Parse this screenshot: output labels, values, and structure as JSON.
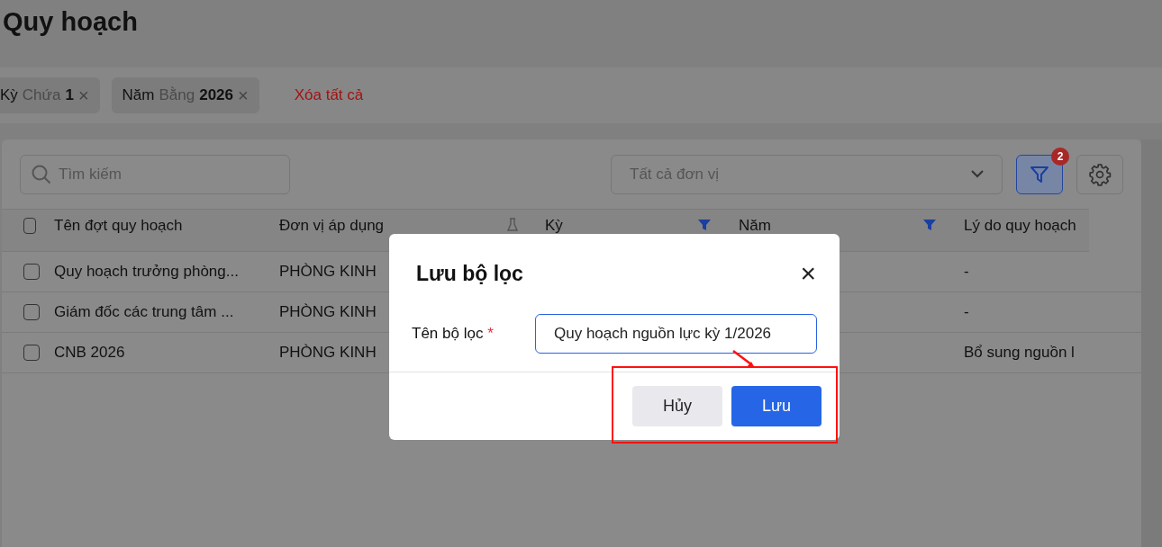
{
  "page": {
    "title": "Quy hoạch"
  },
  "filter_chips": [
    {
      "field": "Kỳ",
      "operator": "Chứa",
      "value": "1",
      "remove": "×"
    },
    {
      "field": "Năm",
      "operator": "Bằng",
      "value": "2026",
      "remove": "×"
    }
  ],
  "clear_all": "Xóa tất cả",
  "toolbar": {
    "search": {
      "placeholder": "Tìm kiếm"
    },
    "unit_select": {
      "placeholder": "Tất cả đơn vị"
    },
    "filter_badge": "2"
  },
  "table": {
    "header_checked": false,
    "columns": [
      {
        "label": "Tên đợt quy hoạch"
      },
      {
        "label": "Đơn vị áp dụng",
        "filtered": false
      },
      {
        "label": "Kỳ",
        "filtered": true
      },
      {
        "label": "Năm",
        "filtered": true
      },
      {
        "label": "Lý do quy hoạch"
      }
    ],
    "rows": [
      {
        "checked": false,
        "name": "Quy hoạch trưởng phòng...",
        "unit": "PHÒNG KINH",
        "reason": "-"
      },
      {
        "checked": false,
        "name": "Giám đốc các trung tâm ...",
        "unit": "PHÒNG KINH",
        "reason": "-"
      },
      {
        "checked": false,
        "name": "CNB 2026",
        "unit": "PHÒNG KINH",
        "reason": "Bổ sung nguồn l"
      }
    ]
  },
  "modal": {
    "title": "Lưu bộ lọc",
    "close": "×",
    "field": {
      "label": "Tên bộ lọc",
      "required_mark": "*",
      "value": "Quy hoạch nguồn lực kỳ 1/2026"
    },
    "buttons": [
      {
        "label": "Hủy",
        "kind": "secondary"
      },
      {
        "label": "Lưu",
        "kind": "primary"
      }
    ]
  }
}
